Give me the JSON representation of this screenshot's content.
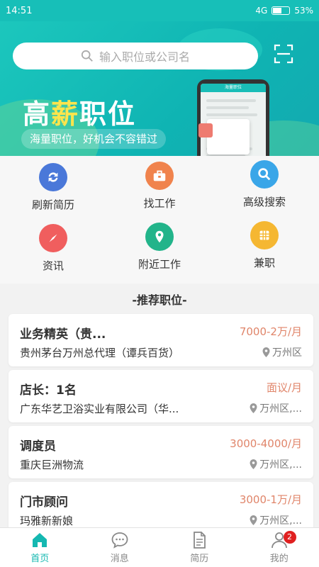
{
  "status_bar": {
    "time": "14:51",
    "signal": "4G",
    "battery": "53%"
  },
  "search": {
    "placeholder": "输入职位或公司名"
  },
  "banner": {
    "title_a": "高",
    "title_b": "薪",
    "title_c": "职位",
    "subtitle": "海量职位，好机会不容错过",
    "phone_header": "海量职位"
  },
  "menu": [
    {
      "label": "刷新简历",
      "icon": "refresh-icon",
      "color": "#4a78d9"
    },
    {
      "label": "找工作",
      "icon": "briefcase-icon",
      "color": "#f0834d"
    },
    {
      "label": "高级搜索",
      "icon": "search-icon",
      "color": "#3aa6e8"
    },
    {
      "label": "资讯",
      "icon": "compass-icon",
      "color": "#f05e5e"
    },
    {
      "label": "附近工作",
      "icon": "location-icon",
      "color": "#22b48a"
    },
    {
      "label": "兼职",
      "icon": "grid-icon",
      "color": "#f5b732"
    }
  ],
  "recommend": {
    "title": "-推荐职位-"
  },
  "jobs": [
    {
      "title": "业务精英（贵...",
      "salary": "7000-2万/月",
      "company": "贵州茅台万州总代理（谭兵百货）",
      "location": "万州区"
    },
    {
      "title": "店长：1名",
      "salary": "面议/月",
      "company": "广东华艺卫浴实业有限公司（华...",
      "location": "万州区,..."
    },
    {
      "title": "调度员",
      "salary": "3000-4000/月",
      "company": "重庆巨洲物流",
      "location": "万州区,..."
    },
    {
      "title": "门市顾问",
      "salary": "3000-1万/月",
      "company": "玛雅新新娘",
      "location": "万州区,..."
    }
  ],
  "tabs": [
    {
      "label": "首页",
      "icon": "home-icon"
    },
    {
      "label": "消息",
      "icon": "message-icon"
    },
    {
      "label": "简历",
      "icon": "resume-icon"
    },
    {
      "label": "我的",
      "icon": "user-icon",
      "badge": "2"
    }
  ],
  "colors": {
    "brand": "#15b8b1",
    "salary": "#e0856a",
    "badge": "#e02020"
  }
}
